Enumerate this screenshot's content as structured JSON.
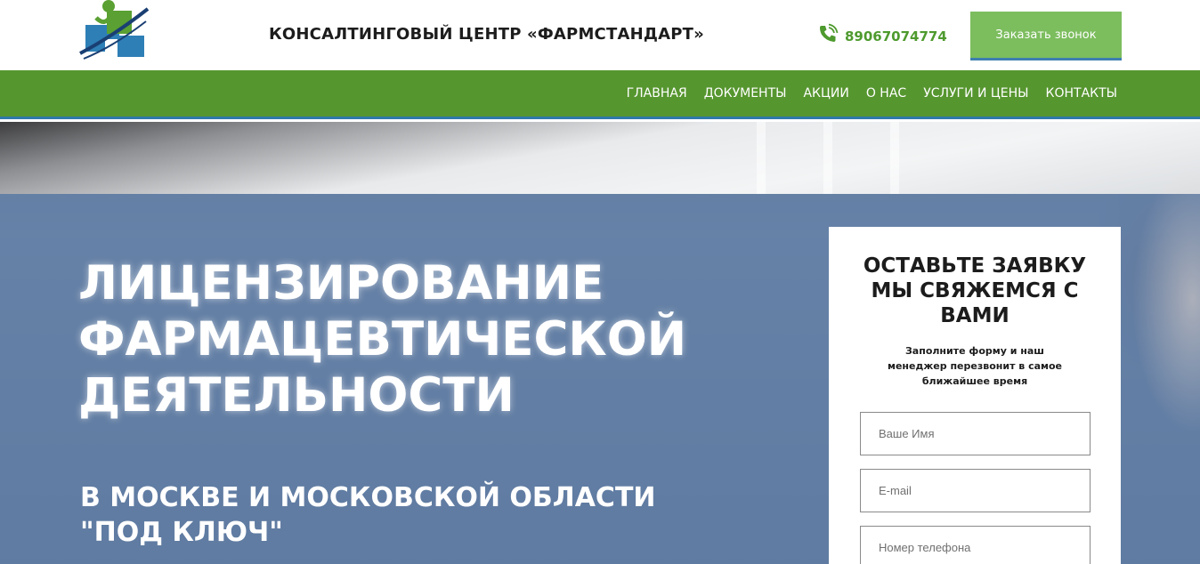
{
  "header": {
    "logo_icon": "pharmacy-cross-logo",
    "site_title": "КОНСАЛТИНГОВЫЙ ЦЕНТР «ФАРМСТАНДАРТ»",
    "phone_icon": "phone-icon",
    "phone": "89067074774",
    "callback_button": "Заказать звонок"
  },
  "nav": {
    "items": [
      {
        "label": "ГЛАВНАЯ"
      },
      {
        "label": "ДОКУМЕНТЫ"
      },
      {
        "label": "АКЦИИ"
      },
      {
        "label": "О НАС"
      },
      {
        "label": "УСЛУГИ И ЦЕНЫ"
      },
      {
        "label": "КОНТАКТЫ"
      }
    ]
  },
  "hero": {
    "title_lines": [
      "ЛИЦЕНЗИРОВАНИЕ",
      "ФАРМАЦЕВТИЧЕСКОЙ",
      "ДЕЯТЕЛЬНОСТИ"
    ],
    "subtitle_lines": [
      "В МОСКВЕ И МОСКОВСКОЙ ОБЛАСТИ",
      "\"ПОД КЛЮЧ\""
    ]
  },
  "form": {
    "title_lines": [
      "ОСТАВЬТЕ ЗАЯВКУ",
      "МЫ СВЯЖЕМСЯ С",
      "ВАМИ"
    ],
    "description_lines": [
      "Заполните форму и наш",
      "менеджер перезвонит в самое",
      "ближайшее время"
    ],
    "name_placeholder": "Ваше Имя",
    "email_placeholder": "E-mail",
    "phone_placeholder": "Номер телефона"
  },
  "colors": {
    "brand_green": "#56962f",
    "accent_blue": "#2f78a8",
    "button_green": "#7cbd5e",
    "hero_overlay": "#48699a"
  }
}
